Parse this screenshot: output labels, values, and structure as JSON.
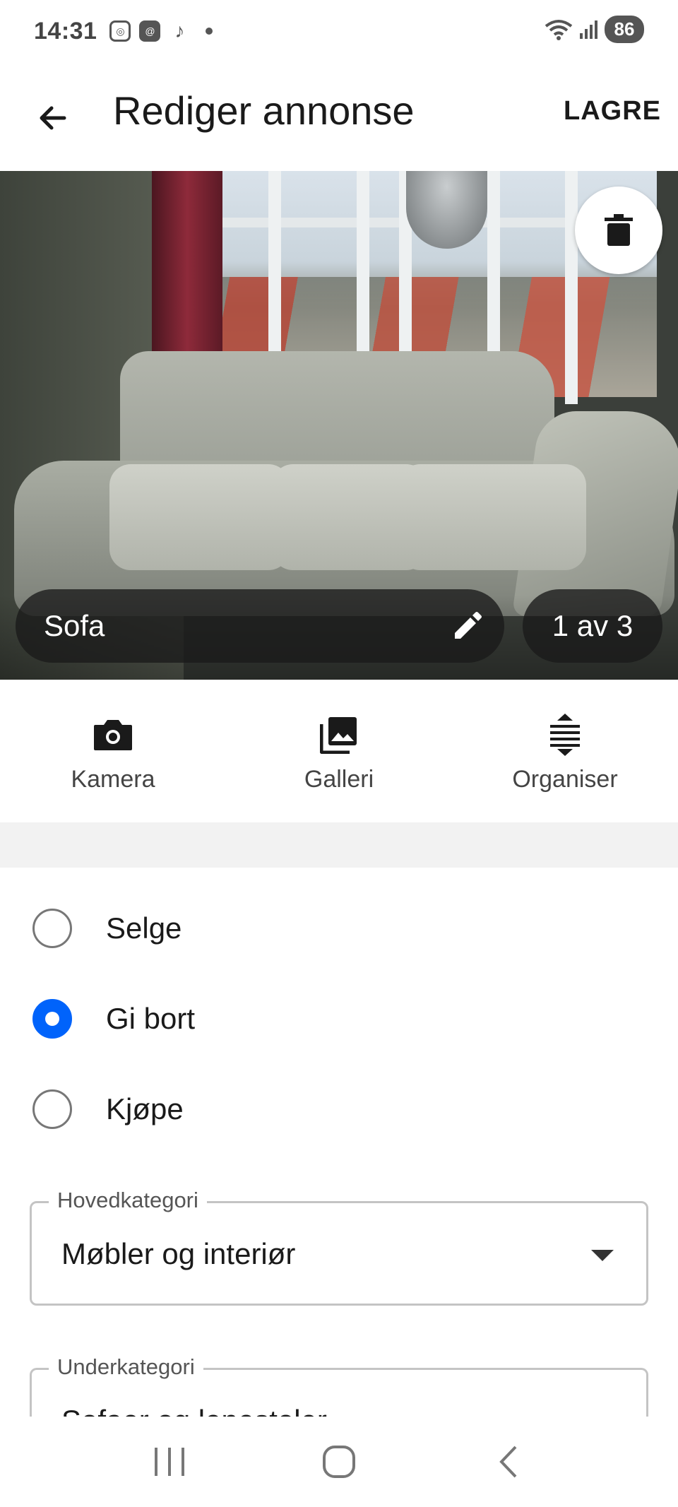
{
  "status_bar": {
    "time": "14:31",
    "battery": "86",
    "left_icons": [
      "instagram-icon",
      "threads-icon",
      "tiktok-icon",
      "notification-dot"
    ],
    "right_icons": [
      "wifi-icon",
      "signal-icon"
    ]
  },
  "app_bar": {
    "back_icon": "arrow-left-icon",
    "title": "Rediger annonse",
    "save_label": "LAGRE"
  },
  "photo": {
    "caption": "Sofa",
    "counter": "1 av 3",
    "delete_icon": "trash-icon",
    "edit_icon": "pencil-icon"
  },
  "actions": [
    {
      "label": "Kamera",
      "icon": "camera-icon"
    },
    {
      "label": "Galleri",
      "icon": "gallery-icon"
    },
    {
      "label": "Organiser",
      "icon": "reorder-icon"
    }
  ],
  "listing_type": {
    "options": [
      {
        "label": "Selge",
        "checked": false
      },
      {
        "label": "Gi bort",
        "checked": true
      },
      {
        "label": "Kjøpe",
        "checked": false
      }
    ]
  },
  "fields": {
    "main_category": {
      "label": "Hovedkategori",
      "value": "Møbler og interiør"
    },
    "sub_category": {
      "label": "Underkategori",
      "value": "Sofaer og lenestoler"
    }
  },
  "colors": {
    "accent": "#0063fb",
    "text": "#1a1a1a",
    "band": "#f2f2f2"
  },
  "nav_bar": [
    "recents-icon",
    "home-icon",
    "back-icon"
  ]
}
